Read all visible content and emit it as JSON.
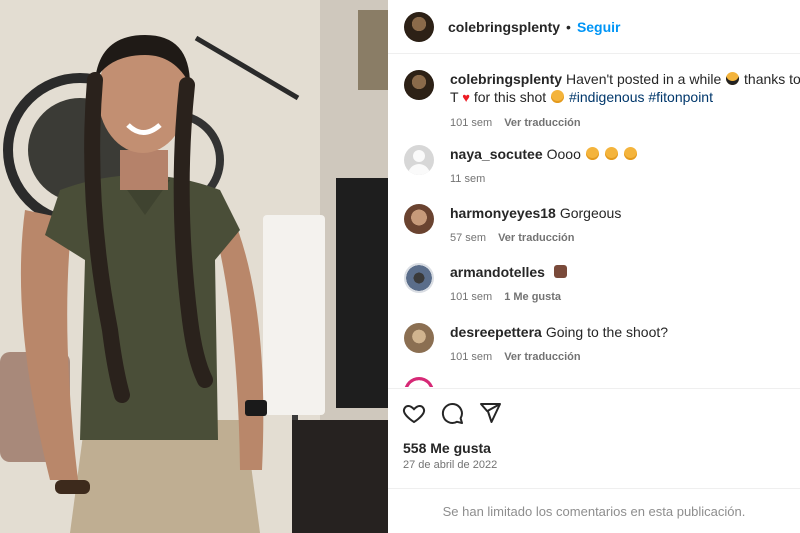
{
  "post": {
    "username": "colebringsplenty",
    "separator": "•",
    "follow_label": "Seguir"
  },
  "caption": {
    "username": "colebringsplenty",
    "text_start": "Haven't posted in a while",
    "text_mid": " thanks to my gi",
    "line2_start": "T",
    "line2_mid": " for this shot",
    "hashtag1": "#indigenous",
    "hashtag2": "#fitonpoint",
    "time": "101 sem",
    "translate": "Ver traducción"
  },
  "comments": [
    {
      "username": "naya_socutee",
      "text": "Oooo",
      "time": "11 sem",
      "action": ""
    },
    {
      "username": "harmonyeyes18",
      "text": "Gorgeous",
      "time": "57 sem",
      "action": "Ver traducción"
    },
    {
      "username": "armandotelles",
      "text": "",
      "time": "101 sem",
      "action": "1 Me gusta"
    },
    {
      "username": "desreepettera",
      "text": "Going to the shoot?",
      "time": "101 sem",
      "action": "Ver traducción"
    }
  ],
  "icons": [
    "heart-icon",
    "comment-icon",
    "share-icon"
  ],
  "likes_label": "558 Me gusta",
  "date_label": "27 de abril de 2022",
  "footer_notice": "Se han limitado los comentarios en esta publicación.",
  "colors": {
    "link": "#0095f6",
    "hashtag": "#00376b",
    "muted": "#737373",
    "heart": "#ed1c24"
  }
}
